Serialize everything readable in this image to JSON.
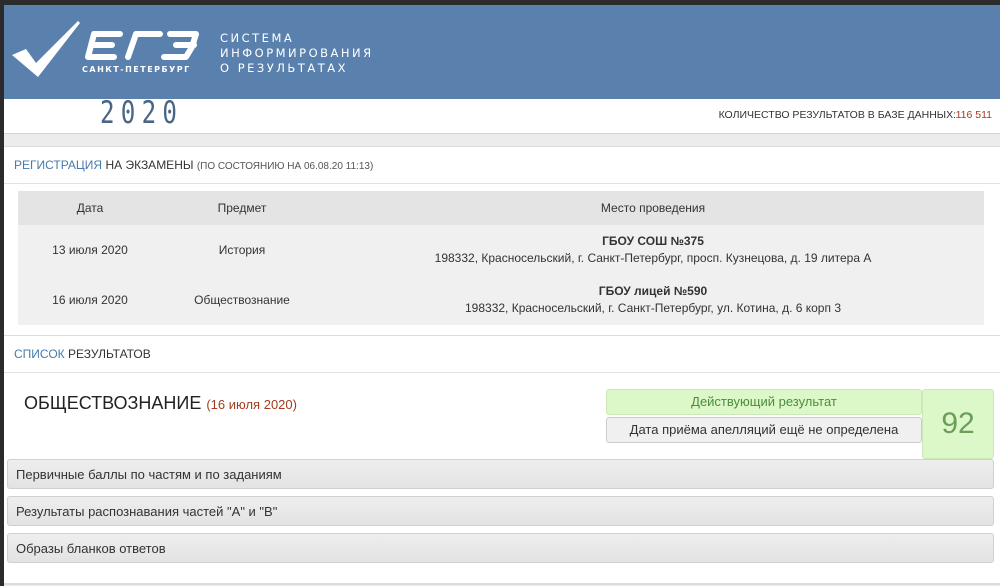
{
  "header": {
    "logo_text": "ЕГЭ",
    "logo_city": "САНКТ-ПЕТЕРБУРГ",
    "system_title": [
      "СИСТЕМА",
      "ИНФОРМИРОВАНИЯ",
      "О РЕЗУЛЬТАТАХ"
    ],
    "year": "2020",
    "count_label": "Количество результатов в базе данных:",
    "count_value": "116 511",
    "header_color": "#5a80ad"
  },
  "registration": {
    "title_highlight": "РЕГИСТРАЦИЯ",
    "title_rest": "НА ЭКЗАМЕНЫ",
    "note": "(ПО СОСТОЯНИЮ НА 06.08.20 11:13)",
    "columns": {
      "date": "Дата",
      "subject": "Предмет",
      "place": "Место проведения"
    },
    "rows": [
      {
        "date": "13 июля 2020",
        "subject": "История",
        "place_name": "ГБОУ СОШ №375",
        "place_address": "198332, Красносельский, г. Санкт-Петербург, просп. Кузнецова, д. 19 литера А"
      },
      {
        "date": "16 июля 2020",
        "subject": "Обществознание",
        "place_name": "ГБОУ лицей №590",
        "place_address": "198332, Красносельский, г. Санкт-Петербург, ул. Котина, д. 6 корп 3"
      }
    ]
  },
  "results": {
    "title_highlight": "СПИСОК",
    "title_rest": "РЕЗУЛЬТАТОВ",
    "subject": "ОБЩЕСТВОЗНАНИЕ",
    "exam_date": "(16 июля 2020)",
    "status": "Действующий результат",
    "appeal": "Дата приёма апелляций ещё не определена",
    "score": "92",
    "sections": [
      "Первичные баллы по частям и по заданиям",
      "Результаты распознавания частей \"А\" и \"В\"",
      "Образы бланков ответов"
    ]
  }
}
